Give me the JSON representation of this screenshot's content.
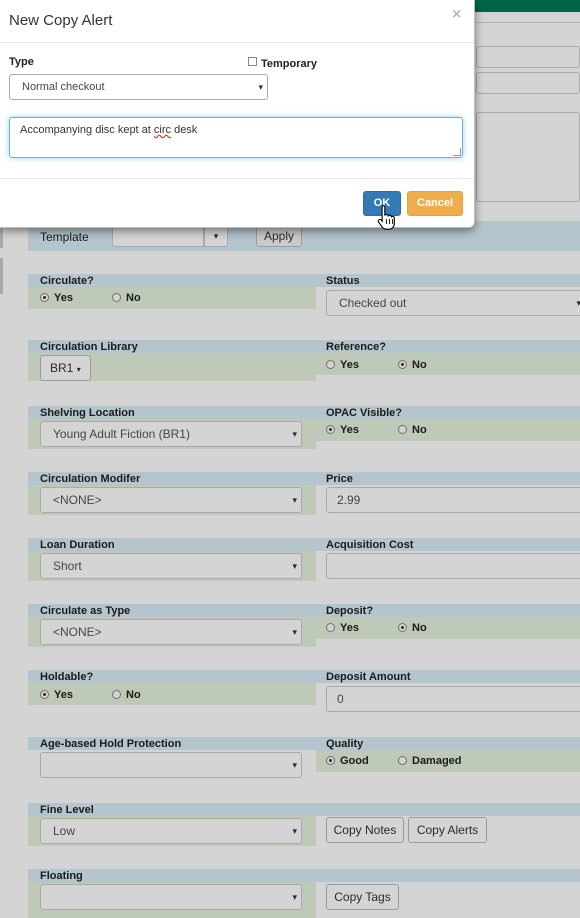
{
  "modal": {
    "title": "New Copy Alert",
    "close_glyph": "×",
    "type_label": "Type",
    "temporary_label": "Temporary",
    "type_value": "Normal checkout",
    "note_before": "Accompanying disc kept at ",
    "note_misspelled": "circ",
    "note_after": " desk",
    "ok_label": "OK",
    "cancel_label": "Cancel"
  },
  "template": {
    "label": "Template",
    "apply_label": "Apply"
  },
  "caret": "▾",
  "fields": {
    "circulate": {
      "label": "Circulate?",
      "yes": "Yes",
      "no": "No",
      "value": "Yes"
    },
    "status": {
      "label": "Status",
      "value": "Checked out"
    },
    "circ_library": {
      "label": "Circulation Library",
      "value": "BR1"
    },
    "reference": {
      "label": "Reference?",
      "yes": "Yes",
      "no": "No",
      "value": "No"
    },
    "shelving": {
      "label": "Shelving Location",
      "value": "Young Adult Fiction (BR1)"
    },
    "opac": {
      "label": "OPAC Visible?",
      "yes": "Yes",
      "no": "No",
      "value": "Yes"
    },
    "circ_modifier": {
      "label": "Circulation Modifer",
      "value": "<NONE>"
    },
    "price": {
      "label": "Price",
      "value": "2.99"
    },
    "loan_duration": {
      "label": "Loan Duration",
      "value": "Short"
    },
    "acq_cost": {
      "label": "Acquisition Cost",
      "value": ""
    },
    "circ_as_type": {
      "label": "Circulate as Type",
      "value": "<NONE>"
    },
    "deposit": {
      "label": "Deposit?",
      "yes": "Yes",
      "no": "No",
      "value": "No"
    },
    "holdable": {
      "label": "Holdable?",
      "yes": "Yes",
      "no": "No",
      "value": "Yes"
    },
    "deposit_amount": {
      "label": "Deposit Amount",
      "value": "0"
    },
    "age_hold": {
      "label": "Age-based Hold Protection",
      "value": ""
    },
    "quality": {
      "label": "Quality",
      "good": "Good",
      "damaged": "Damaged",
      "value": "Good"
    },
    "fine_level": {
      "label": "Fine Level",
      "value": "Low"
    },
    "floating": {
      "label": "Floating",
      "value": ""
    }
  },
  "buttons": {
    "copy_notes": "Copy Notes",
    "copy_alerts": "Copy Alerts",
    "copy_tags": "Copy Tags"
  },
  "colors": {
    "primary": "#337ab7",
    "warning": "#f0ad4e",
    "header_band": "#d9edf7",
    "value_band": "#e6f2dc",
    "brand_green": "#007a55"
  }
}
